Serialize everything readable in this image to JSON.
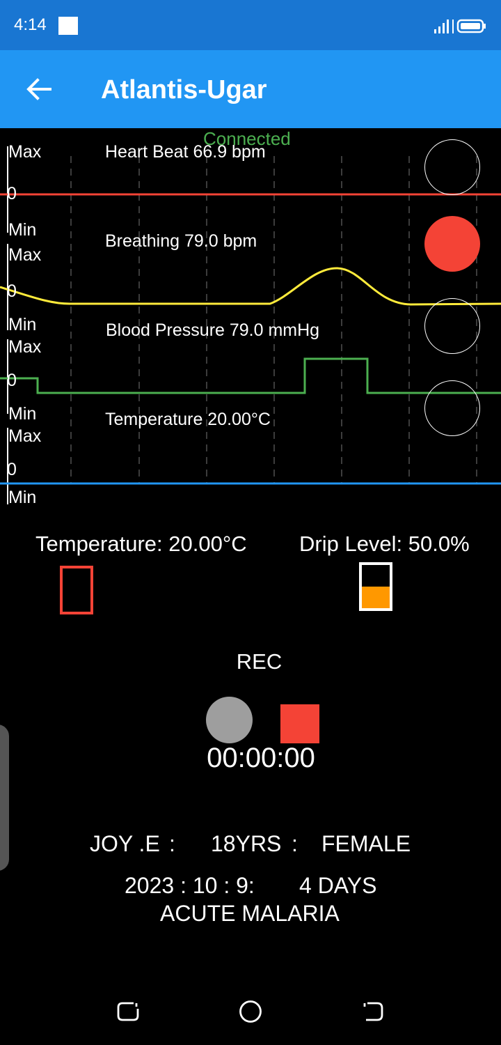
{
  "status_bar": {
    "time": "4:14",
    "icons": [
      "notification-square-icon",
      "signal-icon",
      "battery-icon"
    ]
  },
  "app_bar": {
    "back_icon": "arrow-left-icon",
    "title": "Atlantis-Ugar"
  },
  "monitor": {
    "connection_status": "Connected",
    "channels": [
      {
        "label": "Heart Beat 66.9 bpm",
        "color": "#f44336",
        "indicator": "outline"
      },
      {
        "label": "Breathing 79.0 bpm",
        "color": "#ffeb3b",
        "indicator": "filled-red"
      },
      {
        "label": "Blood Pressure 79.0 mmHg",
        "color": "#4caf50",
        "indicator": "outline"
      },
      {
        "label": "Temperature  20.00°C",
        "color": "#2196f3",
        "indicator": "outline"
      }
    ],
    "axis_labels": {
      "max": "Max",
      "zero": "0",
      "min": "Min"
    }
  },
  "readouts": {
    "temperature": "Temperature:  20.00°C",
    "drip_level": "Drip Level: 50.0%",
    "drip_fraction": 0.5
  },
  "recorder": {
    "label": "REC",
    "timer": "00:00:00"
  },
  "patient": {
    "name": "JOY .E",
    "sep1": ":",
    "age": "18YRS",
    "sep2": ":",
    "gender": "FEMALE",
    "date": "2023 : 10 : 9:",
    "duration": "4 DAYS",
    "diagnosis": "ACUTE MALARIA"
  },
  "nav_bar": {
    "icons": [
      "recents-icon",
      "home-icon",
      "back-icon"
    ]
  },
  "colors": {
    "status_bar": "#1976d2",
    "app_bar": "#2196f3",
    "alert_red": "#f44336",
    "drip_orange": "#ff9800"
  }
}
